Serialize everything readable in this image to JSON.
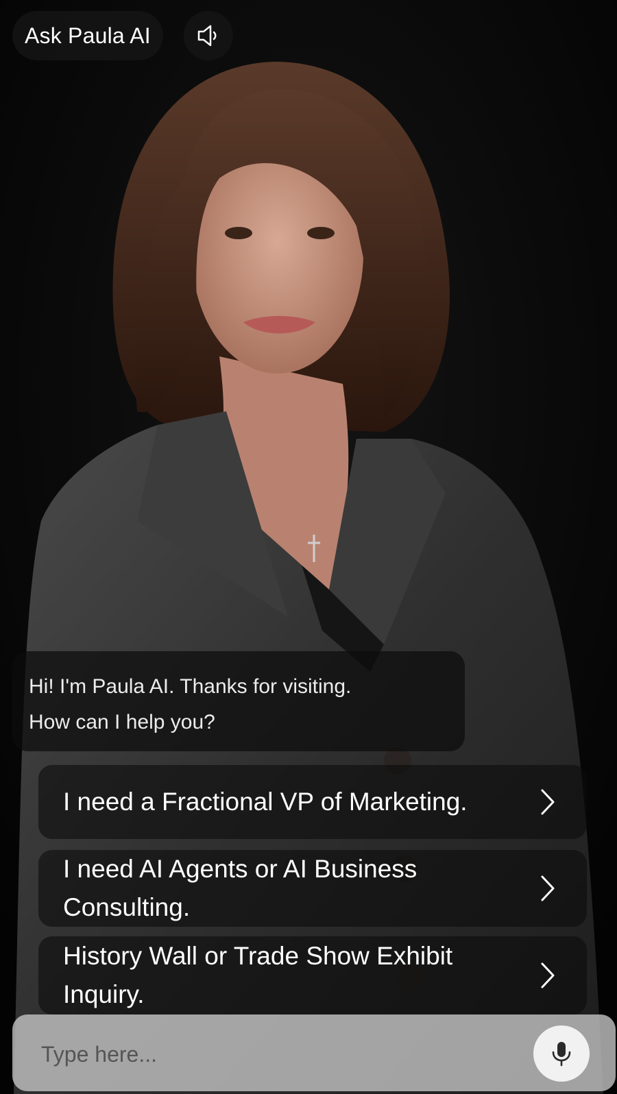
{
  "header": {
    "title": "Ask Paula AI",
    "sound_icon": "speaker-icon"
  },
  "chat": {
    "greeting_line_1": "Hi! I'm Paula AI. Thanks for visiting.",
    "greeting_line_2": "How can I help you?"
  },
  "options": [
    {
      "label": "I need a Fractional VP of Marketing.",
      "icon": "chevron-right-icon"
    },
    {
      "label": "I need AI Agents or AI Business Consulting.",
      "icon": "chevron-right-icon"
    },
    {
      "label": "History Wall or Trade Show Exhibit Inquiry.",
      "icon": "chevron-right-icon"
    }
  ],
  "input": {
    "placeholder": "Type here...",
    "value": "",
    "mic_icon": "microphone-icon"
  },
  "colors": {
    "background": "#060606",
    "text": "#ffffff",
    "input_bar": "#c8c8c8",
    "mic_button": "#f1f1f1"
  }
}
